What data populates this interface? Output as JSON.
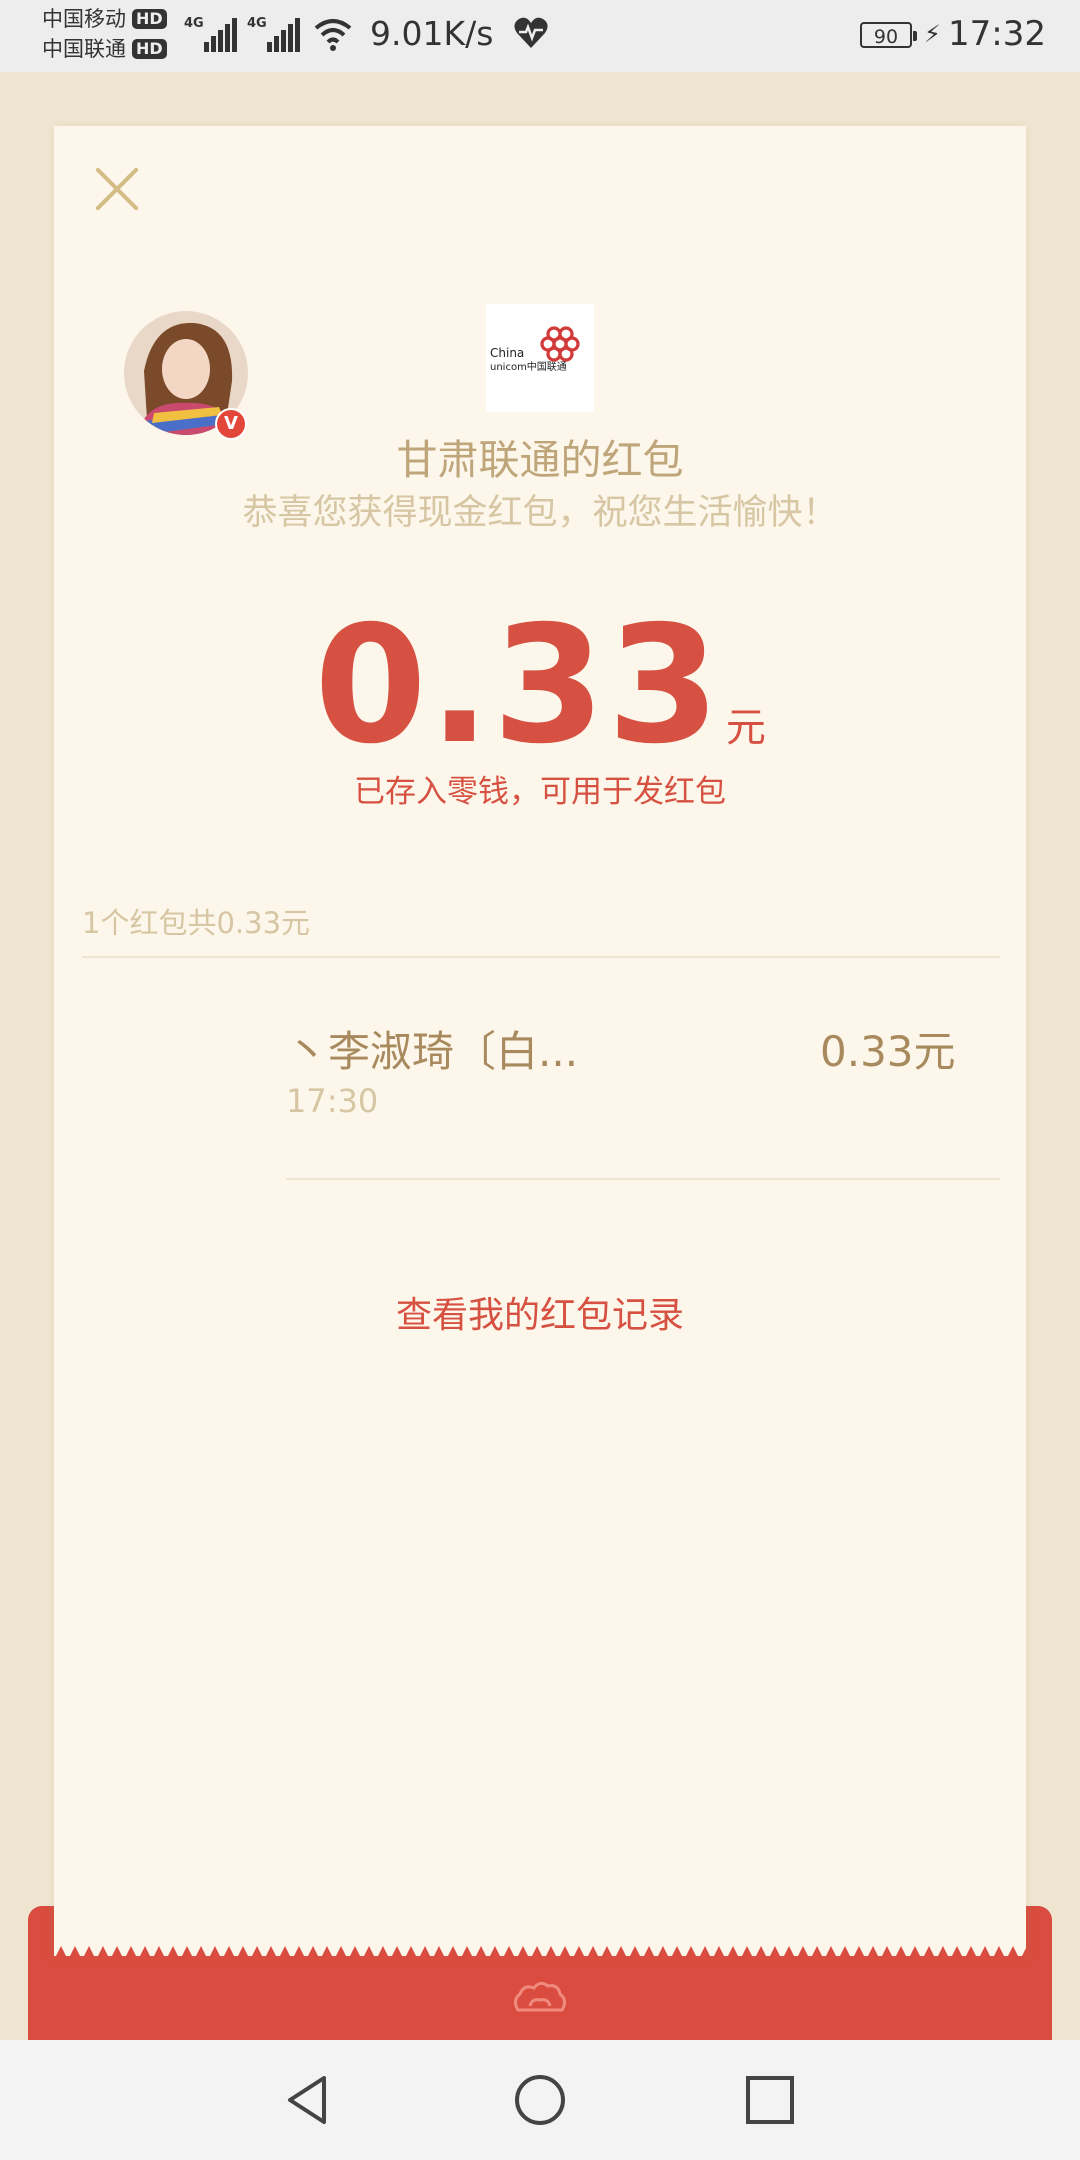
{
  "status_bar": {
    "carrier_1": "中国移动",
    "carrier_2": "中国联通",
    "hd_label": "HD",
    "network_tag": "4G",
    "net_speed": "9.01K/s",
    "battery": "90",
    "time": "17:32"
  },
  "packet": {
    "logo_name": "China unicom 中国联通",
    "logo_text_1": "China",
    "logo_text_2": "unicom中国联通",
    "sender_title": "甘肃联通的红包",
    "blessing": "恭喜您获得现金红包，祝您生活愉快！",
    "amount": "0.33",
    "unit": "元",
    "stored_note": "已存入零钱，可用于发红包",
    "summary": "1个红包共0.33元",
    "list": [
      {
        "name": "丶李淑琦〔白...",
        "time": "17:30",
        "amount": "0.33元"
      }
    ],
    "record_link": "查看我的红包记录"
  },
  "colors": {
    "accent_red": "#d65141",
    "gold_text": "#bfa57a",
    "muted_gold": "#d7c6a3",
    "card_bg": "#fcf7ea",
    "page_bg": "#efe6d2"
  },
  "icons": {
    "close": "close-icon",
    "wifi": "wifi-icon",
    "heart": "heart-rate-icon",
    "charging": "charging-icon",
    "back": "back-icon",
    "home": "home-icon",
    "recents": "recents-icon",
    "packet_emblem": "cloud-emblem-icon"
  }
}
